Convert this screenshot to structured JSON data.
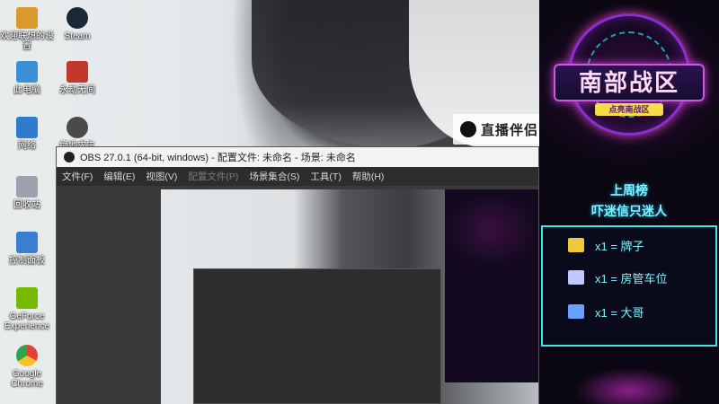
{
  "desktop": {
    "icons": [
      {
        "label": "欢迎联想的设置",
        "color": "#d99a2b"
      },
      {
        "label": "Steam",
        "color": "#1b2838"
      },
      {
        "label": "此电脑",
        "color": "#3a8fd6"
      },
      {
        "label": "永劫无间",
        "color": "#c0392b"
      },
      {
        "label": "网络",
        "color": "#2f7bd0"
      },
      {
        "label": "绝地求生",
        "color": "#4a4a4a"
      },
      {
        "label": "回收站",
        "color": "#9aa3ad"
      },
      {
        "label": "控制面板",
        "color": "#3b7fd1"
      },
      {
        "label": "GeForce Experience",
        "color": "#76b900"
      },
      {
        "label": "Google Chrome",
        "color": "#e34133"
      }
    ],
    "watermark": "直播伴侣"
  },
  "obs": {
    "title": "OBS 27.0.1 (64-bit, windows) - 配置文件: 未命名 - 场景: 未命名",
    "menu": [
      {
        "label": "文件(F)",
        "disabled": false
      },
      {
        "label": "编辑(E)",
        "disabled": false
      },
      {
        "label": "视图(V)",
        "disabled": false
      },
      {
        "label": "配置文件(P)",
        "disabled": true
      },
      {
        "label": "场景集合(S)",
        "disabled": false
      },
      {
        "label": "工具(T)",
        "disabled": false
      },
      {
        "label": "帮助(H)",
        "disabled": false
      }
    ]
  },
  "overlay": {
    "banner_title": "南部战区",
    "banner_sub": "点亮南战区",
    "weekly_title": "上周榜",
    "weekly_name": "吓迷信只迷人",
    "ranks": [
      {
        "text": "x1 = 牌子",
        "icon": "badge-icon",
        "color": "#f0c83a"
      },
      {
        "text": "x1 = 房管车位",
        "icon": "car-icon",
        "color": "#c0c8ff"
      },
      {
        "text": "x1 = 大哥",
        "icon": "rocket-icon",
        "color": "#6aa0ff"
      }
    ]
  }
}
